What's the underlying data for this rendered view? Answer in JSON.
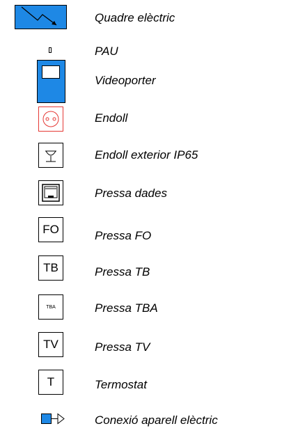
{
  "legend": {
    "items": [
      {
        "symbol": "electrical-panel-icon",
        "label": "Quadre elèctric"
      },
      {
        "symbol": "pau-icon",
        "label": "PAU"
      },
      {
        "symbol": "video-intercom-icon",
        "label": "Videoporter"
      },
      {
        "symbol": "socket-icon",
        "label": "Endoll"
      },
      {
        "symbol": "outdoor-socket-icon",
        "label": "Endoll exterior IP65"
      },
      {
        "symbol": "data-outlet-icon",
        "label": "Pressa dades"
      },
      {
        "symbol": "fo-outlet-icon",
        "label": "Pressa FO",
        "code": "FO"
      },
      {
        "symbol": "tb-outlet-icon",
        "label": "Pressa TB",
        "code": "TB"
      },
      {
        "symbol": "tba-outlet-icon",
        "label": "Pressa TBA",
        "code": "TBA"
      },
      {
        "symbol": "tv-outlet-icon",
        "label": "Pressa TV",
        "code": "TV"
      },
      {
        "symbol": "thermostat-icon",
        "label": "Termostat",
        "code": "T"
      },
      {
        "symbol": "appliance-connection-icon",
        "label": "Conexió aparell elèctric"
      }
    ]
  },
  "colors": {
    "blue": "#1e88e5",
    "red": "#e53935",
    "black": "#000000"
  }
}
